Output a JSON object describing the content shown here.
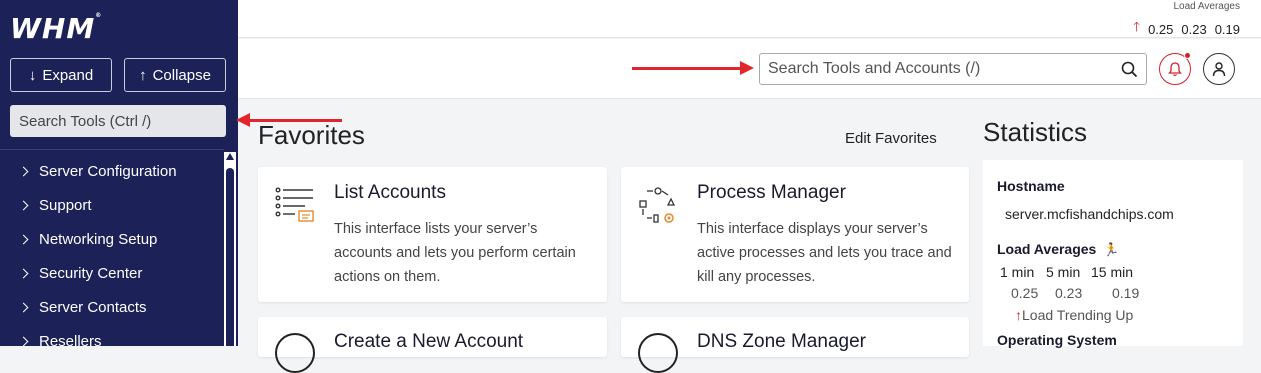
{
  "sidebar": {
    "logo": "WHM",
    "expand_label": "Expand",
    "collapse_label": "Collapse",
    "search_placeholder": "Search Tools (Ctrl /)",
    "items": [
      {
        "label": "Server Configuration"
      },
      {
        "label": "Support"
      },
      {
        "label": "Networking Setup"
      },
      {
        "label": "Security Center"
      },
      {
        "label": "Server Contacts"
      },
      {
        "label": "Resellers"
      }
    ]
  },
  "topbar": {
    "load_title": "Load Averages",
    "load_values": [
      "0.25",
      "0.23",
      "0.19"
    ]
  },
  "header": {
    "search_placeholder": "Search Tools and Accounts (/)"
  },
  "favorites": {
    "title": "Favorites",
    "edit_label": "Edit Favorites",
    "cards": [
      {
        "title": "List Accounts",
        "description": "This interface lists your server’s accounts and lets you perform certain actions on them."
      },
      {
        "title": "Process Manager",
        "description": "This interface displays your server’s active processes and lets you trace and kill any processes."
      },
      {
        "title": "Create a New Account"
      },
      {
        "title": "DNS Zone Manager"
      }
    ]
  },
  "statistics": {
    "title": "Statistics",
    "hostname_label": "Hostname",
    "hostname": "server.mcfishandchips.com",
    "load_label": "Load Averages",
    "periods": [
      "1 min",
      "5 min",
      "15 min"
    ],
    "values": [
      "0.25",
      "0.23",
      "0.19"
    ],
    "trend": "Load Trending Up",
    "os_label": "Operating System"
  },
  "colors": {
    "sidebar_bg": "#1c2158",
    "accent_red": "#d3222a",
    "annotation_arrow": "#e0262b"
  },
  "icons": [
    "down-arrow-icon",
    "up-arrow-icon",
    "chevron-right-icon",
    "search-icon",
    "bell-icon",
    "user-icon",
    "list-accounts-icon",
    "process-manager-icon",
    "running-figure-icon"
  ]
}
